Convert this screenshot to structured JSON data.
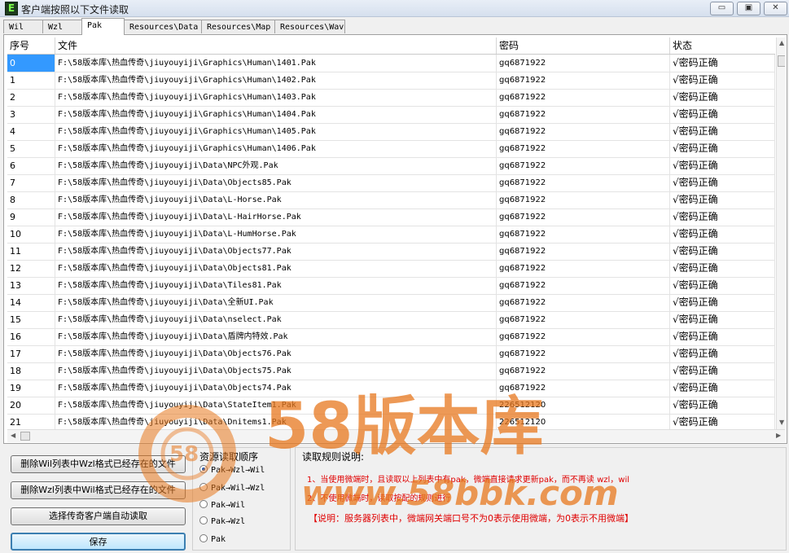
{
  "window": {
    "title": "客户端按照以下文件读取",
    "icon_letter": "E",
    "buttons": {
      "minimize": "▭",
      "restore": "▣",
      "close": "✕"
    }
  },
  "tabs": [
    {
      "label": "Wil",
      "active": false
    },
    {
      "label": "Wzl",
      "active": false
    },
    {
      "label": "Pak",
      "active": true
    },
    {
      "label": "Resources\\Data",
      "active": false
    },
    {
      "label": "Resources\\Map",
      "active": false
    },
    {
      "label": "Resources\\Wav",
      "active": false
    }
  ],
  "grid": {
    "columns": [
      "序号",
      "文件",
      "密码",
      "状态"
    ],
    "rows": [
      {
        "idx": "0",
        "file": "F:\\58版本库\\热血传奇\\jiuyouyiji\\Graphics\\Human\\1401.Pak",
        "pwd": "gq6871922",
        "status": "√密码正确"
      },
      {
        "idx": "1",
        "file": "F:\\58版本库\\热血传奇\\jiuyouyiji\\Graphics\\Human\\1402.Pak",
        "pwd": "gq6871922",
        "status": "√密码正确"
      },
      {
        "idx": "2",
        "file": "F:\\58版本库\\热血传奇\\jiuyouyiji\\Graphics\\Human\\1403.Pak",
        "pwd": "gq6871922",
        "status": "√密码正确"
      },
      {
        "idx": "3",
        "file": "F:\\58版本库\\热血传奇\\jiuyouyiji\\Graphics\\Human\\1404.Pak",
        "pwd": "gq6871922",
        "status": "√密码正确"
      },
      {
        "idx": "4",
        "file": "F:\\58版本库\\热血传奇\\jiuyouyiji\\Graphics\\Human\\1405.Pak",
        "pwd": "gq6871922",
        "status": "√密码正确"
      },
      {
        "idx": "5",
        "file": "F:\\58版本库\\热血传奇\\jiuyouyiji\\Graphics\\Human\\1406.Pak",
        "pwd": "gq6871922",
        "status": "√密码正确"
      },
      {
        "idx": "6",
        "file": "F:\\58版本库\\热血传奇\\jiuyouyiji\\Data\\NPC外观.Pak",
        "pwd": "gq6871922",
        "status": "√密码正确"
      },
      {
        "idx": "7",
        "file": "F:\\58版本库\\热血传奇\\jiuyouyiji\\Data\\Objects85.Pak",
        "pwd": "gq6871922",
        "status": "√密码正确"
      },
      {
        "idx": "8",
        "file": "F:\\58版本库\\热血传奇\\jiuyouyiji\\Data\\L-Horse.Pak",
        "pwd": "gq6871922",
        "status": "√密码正确"
      },
      {
        "idx": "9",
        "file": "F:\\58版本库\\热血传奇\\jiuyouyiji\\Data\\L-HairHorse.Pak",
        "pwd": "gq6871922",
        "status": "√密码正确"
      },
      {
        "idx": "10",
        "file": "F:\\58版本库\\热血传奇\\jiuyouyiji\\Data\\L-HumHorse.Pak",
        "pwd": "gq6871922",
        "status": "√密码正确"
      },
      {
        "idx": "11",
        "file": "F:\\58版本库\\热血传奇\\jiuyouyiji\\Data\\Objects77.Pak",
        "pwd": "gq6871922",
        "status": "√密码正确"
      },
      {
        "idx": "12",
        "file": "F:\\58版本库\\热血传奇\\jiuyouyiji\\Data\\Objects81.Pak",
        "pwd": "gq6871922",
        "status": "√密码正确"
      },
      {
        "idx": "13",
        "file": "F:\\58版本库\\热血传奇\\jiuyouyiji\\Data\\Tiles81.Pak",
        "pwd": "gq6871922",
        "status": "√密码正确"
      },
      {
        "idx": "14",
        "file": "F:\\58版本库\\热血传奇\\jiuyouyiji\\Data\\全新UI.Pak",
        "pwd": "gq6871922",
        "status": "√密码正确"
      },
      {
        "idx": "15",
        "file": "F:\\58版本库\\热血传奇\\jiuyouyiji\\Data\\nselect.Pak",
        "pwd": "gq6871922",
        "status": "√密码正确"
      },
      {
        "idx": "16",
        "file": "F:\\58版本库\\热血传奇\\jiuyouyiji\\Data\\盾牌内特效.Pak",
        "pwd": "gq6871922",
        "status": "√密码正确"
      },
      {
        "idx": "17",
        "file": "F:\\58版本库\\热血传奇\\jiuyouyiji\\Data\\Objects76.Pak",
        "pwd": "gq6871922",
        "status": "√密码正确"
      },
      {
        "idx": "18",
        "file": "F:\\58版本库\\热血传奇\\jiuyouyiji\\Data\\Objects75.Pak",
        "pwd": "gq6871922",
        "status": "√密码正确"
      },
      {
        "idx": "19",
        "file": "F:\\58版本库\\热血传奇\\jiuyouyiji\\Data\\Objects74.Pak",
        "pwd": "gq6871922",
        "status": "√密码正确"
      },
      {
        "idx": "20",
        "file": "F:\\58版本库\\热血传奇\\jiuyouyiji\\Data\\StateItem1.Pak",
        "pwd": "226512120",
        "status": "√密码正确"
      },
      {
        "idx": "21",
        "file": "F:\\58版本库\\热血传奇\\jiuyouyiji\\Data\\Dnitems1.Pak",
        "pwd": "226512120",
        "status": "√密码正确"
      }
    ]
  },
  "actions": {
    "del_wil": "删除Wil列表中Wzl格式已经存在的文件",
    "del_wzl": "删除Wzl列表中Wil格式已经存在的文件",
    "auto_read": "选择传奇客户端自动读取",
    "save": "保存"
  },
  "order": {
    "label": "资源读取顺序",
    "options": [
      {
        "label": "Pak→Wzl→Wil",
        "checked": true
      },
      {
        "label": "Pak→Wil→Wzl",
        "checked": false
      },
      {
        "label": "Pak→Wil",
        "checked": false
      },
      {
        "label": "Pak→Wzl",
        "checked": false
      },
      {
        "label": "Pak",
        "checked": false
      }
    ]
  },
  "rules": {
    "label": "读取规则说明:",
    "line1": "1、当使用微端时，且读取以上列表中有pak，微端直接请求更新pak，而不再读 wzl，wil",
    "line2": "2、不使用微端时，读取按配的规则进行",
    "note": "【说明：服务器列表中，微端网关端口号不为0表示使用微端，为0表示不用微端】"
  },
  "watermark": {
    "big": "58版本库",
    "url": "www.58bbk.com",
    "badge": "58"
  },
  "colors": {
    "selection": "#3399ff",
    "rule_text": "#e00000",
    "watermark": "#e8781e"
  }
}
